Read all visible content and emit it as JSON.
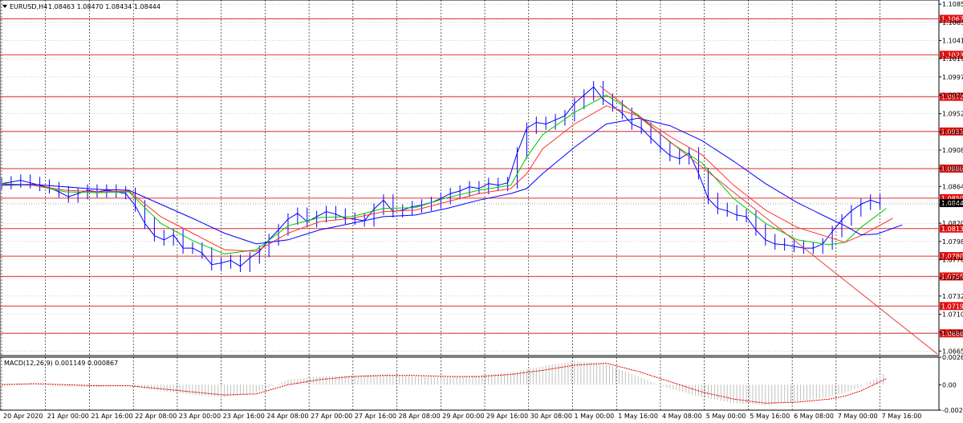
{
  "chart_data": [
    {
      "type": "line",
      "symbol_header": "EURUSD,H4",
      "ohlc_header": "1.08463 1.08470 1.08434 1.08444",
      "current_price": "1.08444",
      "ylim": [
        1.066,
        1.109
      ],
      "grid": true,
      "y_ticks": [
        "1.10850",
        "1.10630",
        "1.10410",
        "1.10190",
        "1.09970",
        "1.09750",
        "1.09525",
        "1.09305",
        "1.09085",
        "1.08865",
        "1.08645",
        "1.08425",
        "1.08200",
        "1.07980",
        "1.07760",
        "1.07540",
        "1.07320",
        "1.07100",
        "1.06880",
        "1.06655"
      ],
      "x_ticks": [
        "20 Apr 2020",
        "21 Apr 00:00",
        "21 Apr 16:00",
        "22 Apr 08:00",
        "23 Apr 00:00",
        "23 Apr 16:00",
        "24 Apr 08:00",
        "27 Apr 00:00",
        "27 Apr 16:00",
        "28 Apr 08:00",
        "29 Apr 00:00",
        "29 Apr 16:00",
        "30 Apr 08:00",
        "1 May 00:00",
        "1 May 16:00",
        "4 May 08:00",
        "5 May 00:00",
        "5 May 16:00",
        "6 May 08:00",
        "7 May 00:00",
        "7 May 16:00"
      ],
      "level_lines": [
        "1.10672",
        "1.10237",
        "1.09729",
        "1.09310",
        "1.08861",
        "1.08504",
        "1.08136",
        "1.07803",
        "1.07557",
        "1.07199",
        "1.06869"
      ],
      "price_path": [
        [
          0,
          1.0868
        ],
        [
          3,
          1.087
        ],
        [
          6,
          1.0872
        ],
        [
          9,
          1.0869
        ],
        [
          12,
          1.0866
        ],
        [
          15,
          1.0863
        ],
        [
          18,
          1.0858
        ],
        [
          21,
          1.0852
        ],
        [
          24,
          1.0856
        ],
        [
          27,
          1.086
        ],
        [
          30,
          1.0858
        ],
        [
          33,
          1.086
        ],
        [
          36,
          1.0858
        ],
        [
          39,
          1.0856
        ],
        [
          42,
          1.0841
        ],
        [
          45,
          1.082
        ],
        [
          48,
          1.0805
        ],
        [
          51,
          1.08
        ],
        [
          54,
          1.0806
        ],
        [
          57,
          1.079
        ],
        [
          60,
          1.079
        ],
        [
          63,
          1.0784
        ],
        [
          66,
          1.077
        ],
        [
          69,
          1.0772
        ],
        [
          72,
          1.0775
        ],
        [
          75,
          1.0768
        ],
        [
          78,
          1.0778
        ],
        [
          81,
          1.0786
        ],
        [
          84,
          1.08
        ],
        [
          87,
          1.0812
        ],
        [
          90,
          1.0825
        ],
        [
          93,
          1.0832
        ],
        [
          96,
          1.0822
        ],
        [
          99,
          1.0828
        ],
        [
          102,
          1.0834
        ],
        [
          105,
          1.0831
        ],
        [
          108,
          1.0826
        ],
        [
          111,
          1.0825
        ],
        [
          114,
          1.0823
        ],
        [
          117,
          1.0837
        ],
        [
          120,
          1.0848
        ],
        [
          123,
          1.0834
        ],
        [
          126,
          1.0836
        ],
        [
          129,
          1.084
        ],
        [
          132,
          1.0842
        ],
        [
          135,
          1.0845
        ],
        [
          138,
          1.085
        ],
        [
          141,
          1.0856
        ],
        [
          144,
          1.0859
        ],
        [
          147,
          1.0864
        ],
        [
          150,
          1.0862
        ],
        [
          153,
          1.0868
        ],
        [
          156,
          1.0866
        ],
        [
          159,
          1.0869
        ],
        [
          162,
          1.0905
        ],
        [
          165,
          1.0935
        ],
        [
          168,
          1.0942
        ],
        [
          171,
          1.094
        ],
        [
          174,
          1.0945
        ],
        [
          177,
          1.095
        ],
        [
          180,
          1.0965
        ],
        [
          183,
          1.0975
        ],
        [
          186,
          1.0985
        ],
        [
          189,
          1.097
        ],
        [
          192,
          1.0962
        ],
        [
          195,
          1.0953
        ],
        [
          198,
          1.094
        ],
        [
          201,
          1.0935
        ],
        [
          204,
          1.0923
        ],
        [
          207,
          1.0912
        ],
        [
          210,
          1.0902
        ],
        [
          213,
          1.0898
        ],
        [
          216,
          1.0905
        ],
        [
          219,
          1.088
        ],
        [
          222,
          1.085
        ],
        [
          225,
          1.0838
        ],
        [
          228,
          1.0835
        ],
        [
          231,
          1.083
        ],
        [
          234,
          1.0828
        ],
        [
          237,
          1.0812
        ],
        [
          240,
          1.08
        ],
        [
          243,
          1.0795
        ],
        [
          246,
          1.0794
        ],
        [
          249,
          1.0792
        ],
        [
          252,
          1.079
        ],
        [
          255,
          1.079
        ],
        [
          258,
          1.0795
        ],
        [
          261,
          1.081
        ],
        [
          264,
          1.0824
        ],
        [
          267,
          1.0835
        ],
        [
          270,
          1.0843
        ],
        [
          273,
          1.0848
        ],
        [
          276,
          1.0844
        ]
      ],
      "series": [
        {
          "name": "",
          "color": "#00c800",
          "values": [
            [
              0,
              1.0868
            ],
            [
              10,
              1.0866
            ],
            [
              20,
              1.0858
            ],
            [
              30,
              1.0857
            ],
            [
              40,
              1.0858
            ],
            [
              50,
              1.082
            ],
            [
              60,
              1.0799
            ],
            [
              70,
              1.0783
            ],
            [
              80,
              1.0788
            ],
            [
              90,
              1.0817
            ],
            [
              100,
              1.0827
            ],
            [
              110,
              1.0828
            ],
            [
              120,
              1.0838
            ],
            [
              130,
              1.0839
            ],
            [
              140,
              1.0851
            ],
            [
              150,
              1.086
            ],
            [
              160,
              1.0866
            ],
            [
              165,
              1.09
            ],
            [
              170,
              1.0927
            ],
            [
              180,
              1.0954
            ],
            [
              190,
              1.0975
            ],
            [
              200,
              1.0951
            ],
            [
              210,
              1.0918
            ],
            [
              220,
              1.0893
            ],
            [
              230,
              1.085
            ],
            [
              240,
              1.082
            ],
            [
              250,
              1.08
            ],
            [
              260,
              1.0794
            ],
            [
              265,
              1.0797
            ],
            [
              270,
              1.0815
            ],
            [
              278,
              1.0838
            ]
          ]
        },
        {
          "name": "",
          "color": "#ff3030",
          "values": [
            [
              0,
              1.0867
            ],
            [
              10,
              1.0866
            ],
            [
              20,
              1.086
            ],
            [
              30,
              1.0858
            ],
            [
              40,
              1.0859
            ],
            [
              50,
              1.0828
            ],
            [
              60,
              1.0808
            ],
            [
              70,
              1.0788
            ],
            [
              80,
              1.0786
            ],
            [
              90,
              1.0808
            ],
            [
              100,
              1.0822
            ],
            [
              110,
              1.0826
            ],
            [
              120,
              1.0834
            ],
            [
              130,
              1.0836
            ],
            [
              140,
              1.0846
            ],
            [
              150,
              1.0856
            ],
            [
              160,
              1.0862
            ],
            [
              165,
              1.088
            ],
            [
              170,
              1.091
            ],
            [
              180,
              1.094
            ],
            [
              190,
              1.0962
            ],
            [
              200,
              1.095
            ],
            [
              210,
              1.0925
            ],
            [
              220,
              1.0903
            ],
            [
              230,
              1.0866
            ],
            [
              240,
              1.0836
            ],
            [
              250,
              1.0815
            ],
            [
              260,
              1.0803
            ],
            [
              265,
              1.0797
            ],
            [
              270,
              1.0805
            ],
            [
              280,
              1.0826
            ]
          ]
        },
        {
          "name": "",
          "color": "#0000ff",
          "values": [
            [
              0,
              1.0866
            ],
            [
              10,
              1.0867
            ],
            [
              20,
              1.0864
            ],
            [
              30,
              1.0861
            ],
            [
              40,
              1.086
            ],
            [
              50,
              1.0843
            ],
            [
              60,
              1.0826
            ],
            [
              70,
              1.0808
            ],
            [
              80,
              1.0795
            ],
            [
              90,
              1.08
            ],
            [
              100,
              1.0812
            ],
            [
              110,
              1.082
            ],
            [
              120,
              1.0828
            ],
            [
              130,
              1.083
            ],
            [
              140,
              1.0838
            ],
            [
              150,
              1.0848
            ],
            [
              160,
              1.0856
            ],
            [
              165,
              1.0862
            ],
            [
              170,
              1.088
            ],
            [
              180,
              1.0912
            ],
            [
              190,
              1.094
            ],
            [
              200,
              1.0947
            ],
            [
              210,
              1.0938
            ],
            [
              220,
              1.092
            ],
            [
              230,
              1.0895
            ],
            [
              240,
              1.0868
            ],
            [
              250,
              1.0845
            ],
            [
              260,
              1.0826
            ],
            [
              265,
              1.0817
            ],
            [
              270,
              1.0806
            ],
            [
              275,
              1.0807
            ],
            [
              283,
              1.0818
            ]
          ]
        }
      ],
      "trendline": [
        [
          188,
          1.0986
        ],
        [
          294,
          1.0662
        ]
      ]
    },
    {
      "type": "bar",
      "label": "MACD(12,26,9) 0.001149 0.000867",
      "y_ticks": [
        "0.002686",
        "0.00",
        "-0.00248"
      ],
      "ylim": [
        -0.00248,
        0.002686
      ],
      "histogram": [
        [
          0,
          0.0001
        ],
        [
          10,
          0.0001
        ],
        [
          20,
          -0.0002
        ],
        [
          30,
          -0.0002
        ],
        [
          40,
          -0.0001
        ],
        [
          50,
          -0.0006
        ],
        [
          60,
          -0.001
        ],
        [
          70,
          -0.0012
        ],
        [
          80,
          -0.0008
        ],
        [
          90,
          0.0005
        ],
        [
          100,
          0.0008
        ],
        [
          110,
          0.0009
        ],
        [
          120,
          0.001
        ],
        [
          130,
          0.0008
        ],
        [
          140,
          0.0007
        ],
        [
          150,
          0.0009
        ],
        [
          160,
          0.0012
        ],
        [
          170,
          0.0018
        ],
        [
          180,
          0.0023
        ],
        [
          190,
          0.002
        ],
        [
          200,
          0.0008
        ],
        [
          210,
          -0.0004
        ],
        [
          220,
          -0.0012
        ],
        [
          230,
          -0.0018
        ],
        [
          240,
          -0.002
        ],
        [
          250,
          -0.0016
        ],
        [
          260,
          -0.0012
        ],
        [
          265,
          -0.0008
        ],
        [
          270,
          -0.0002
        ],
        [
          278,
          0.0012
        ]
      ],
      "signal": [
        [
          0,
          0.0
        ],
        [
          10,
          0.0001
        ],
        [
          20,
          0.0
        ],
        [
          30,
          -0.0001
        ],
        [
          40,
          -0.0001
        ],
        [
          50,
          -0.0004
        ],
        [
          60,
          -0.0007
        ],
        [
          70,
          -0.001
        ],
        [
          80,
          -0.0009
        ],
        [
          90,
          0.0
        ],
        [
          100,
          0.0005
        ],
        [
          110,
          0.0008
        ],
        [
          120,
          0.0009
        ],
        [
          130,
          0.0009
        ],
        [
          140,
          0.0008
        ],
        [
          150,
          0.0008
        ],
        [
          160,
          0.001
        ],
        [
          170,
          0.0014
        ],
        [
          180,
          0.0019
        ],
        [
          190,
          0.0021
        ],
        [
          200,
          0.0013
        ],
        [
          210,
          0.0003
        ],
        [
          220,
          -0.0007
        ],
        [
          230,
          -0.0014
        ],
        [
          240,
          -0.0018
        ],
        [
          250,
          -0.0017
        ],
        [
          260,
          -0.0014
        ],
        [
          265,
          -0.0011
        ],
        [
          270,
          -0.0006
        ],
        [
          278,
          0.0006
        ]
      ]
    }
  ]
}
